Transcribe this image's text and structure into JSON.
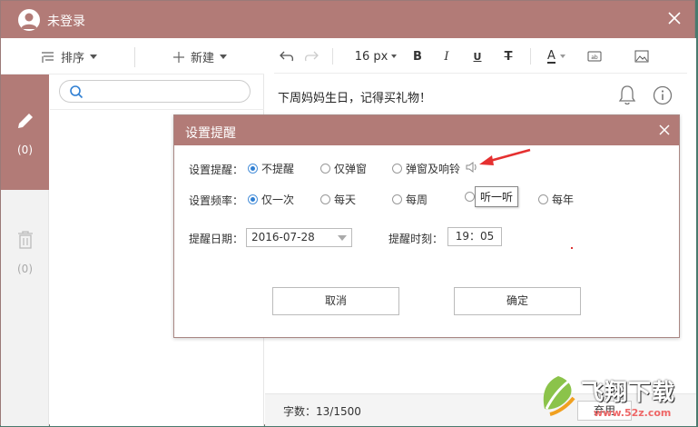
{
  "app": {
    "title": "未登录",
    "colors": {
      "accent": "#b27b77",
      "radio_selected": "#2f7fd3",
      "arrow": "#e53030"
    }
  },
  "left_toolbar": {
    "sort_label": "排序",
    "new_label": "新建"
  },
  "sidebar": {
    "notes_count": "(0)",
    "trash_count": "(0)"
  },
  "search": {
    "placeholder": ""
  },
  "editor_toolbar": {
    "font_size": "16 px",
    "bold": "B",
    "italic": "I",
    "underline": "U",
    "strike": "T",
    "font_color": "A"
  },
  "note": {
    "text": "下周妈妈生日，记得买礼物！"
  },
  "status": {
    "word_count": "字数：13/1500",
    "button_label": "弃用"
  },
  "dialog": {
    "title": "设置提醒",
    "reminder_label": "设置提醒：",
    "reminder_options": [
      "不提醒",
      "仅弹窗",
      "弹窗及响铃"
    ],
    "reminder_selected": "不提醒",
    "frequency_label": "设置频率：",
    "frequency_options": [
      "仅一次",
      "每天",
      "每周",
      "",
      "每年"
    ],
    "frequency_selected": "仅一次",
    "tooltip": "听一听",
    "date_label": "提醒日期：",
    "date_value": "2016-07-28",
    "time_label": "提醒时刻：",
    "time_value": "19：05",
    "cancel_label": "取消",
    "ok_label": "确定"
  },
  "watermark": {
    "text": "飞翔下载",
    "url": "www.52z.com"
  }
}
